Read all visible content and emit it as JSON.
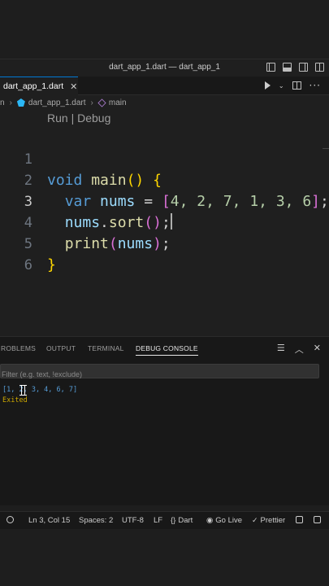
{
  "window": {
    "title": "dart_app_1.dart — dart_app_1"
  },
  "tab": {
    "label": "dart_app_1.dart",
    "close": "✕"
  },
  "breadcrumb": {
    "prefix": "n",
    "file": "dart_app_1.dart",
    "symbol": "main"
  },
  "editor": {
    "codelens": "Run | Debug",
    "line_numbers": [
      "1",
      "2",
      "3",
      "4",
      "5",
      "6"
    ],
    "lines": {
      "l1": {
        "kw": "void",
        "fn": "main",
        "open": "()",
        "brace": "{"
      },
      "l2": {
        "kw": "var",
        "id": "nums",
        "eq": "=",
        "lb": "[",
        "nums": "4, 2, 7, 1, 3, 6",
        "rb": "]",
        "semi": ";"
      },
      "l3": {
        "id": "nums",
        "dot": ".",
        "fn": "sort",
        "paren": "()",
        "semi": ";"
      },
      "l4": {
        "fn": "print",
        "lp": "(",
        "id": "nums",
        "rp": ")",
        "semi": ";"
      },
      "l5": {
        "brace": "}"
      }
    }
  },
  "panel": {
    "tabs": [
      "ROBLEMS",
      "OUTPUT",
      "TERMINAL",
      "DEBUG CONSOLE"
    ],
    "active_tab": "DEBUG CONSOLE",
    "filter_placeholder": "Filter (e.g. text, !exclude)",
    "output": [
      "[1, 2, 3, 4, 6, 7]",
      "Exited"
    ]
  },
  "status": {
    "position": "Ln 3, Col 15",
    "spaces": "Spaces: 2",
    "encoding": "UTF-8",
    "eol": "LF",
    "language": "Dart",
    "golive": "Go Live",
    "prettier": "Prettier"
  },
  "colors": {
    "keyword": "#569cd6",
    "function": "#dcdcaa",
    "variable": "#9cdcfe",
    "number": "#b5cea8",
    "bracket1": "#ffd700",
    "bracket2": "#da70d6",
    "exited": "#cca700"
  }
}
